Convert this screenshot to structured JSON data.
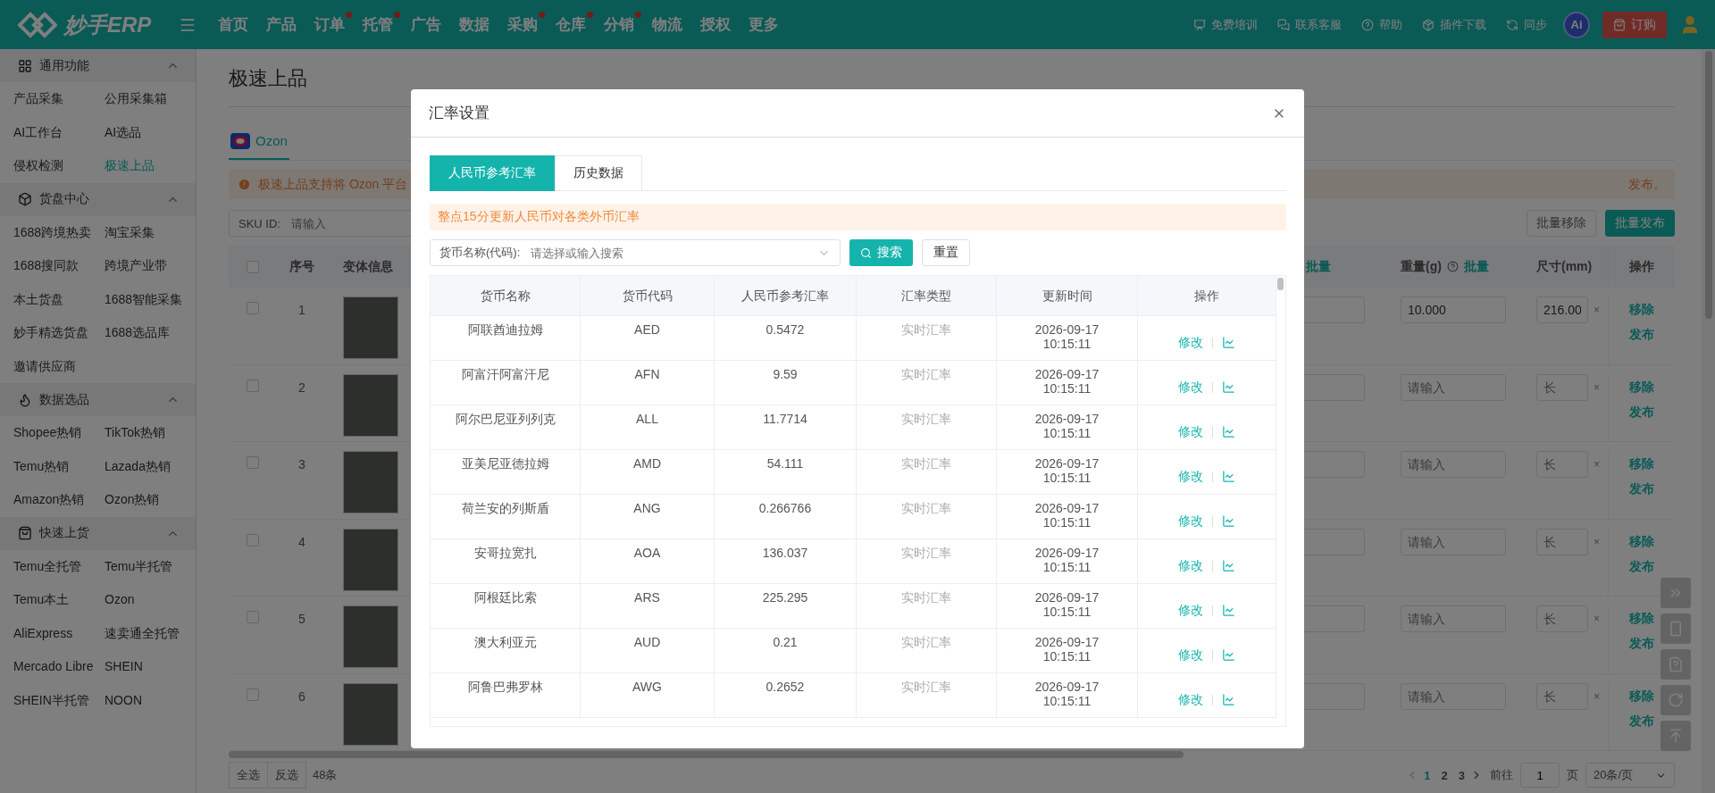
{
  "topbar": {
    "logo_text": "妙手ERP",
    "nav": [
      {
        "label": "首页",
        "dot": false
      },
      {
        "label": "产品",
        "dot": false
      },
      {
        "label": "订单",
        "dot": true
      },
      {
        "label": "托管",
        "dot": true
      },
      {
        "label": "广告",
        "dot": false
      },
      {
        "label": "数据",
        "dot": false
      },
      {
        "label": "采购",
        "dot": true
      },
      {
        "label": "仓库",
        "dot": true
      },
      {
        "label": "分销",
        "dot": true
      },
      {
        "label": "物流",
        "dot": false
      },
      {
        "label": "授权",
        "dot": false
      },
      {
        "label": "更多",
        "dot": false
      }
    ],
    "tools": [
      {
        "label": "免费培训"
      },
      {
        "label": "联系客服"
      },
      {
        "label": "帮助"
      },
      {
        "label": "插件下载"
      },
      {
        "label": "同步"
      }
    ],
    "ai_badge": "Ai",
    "order_button": "订购"
  },
  "sidebar": {
    "groups": [
      {
        "title": "通用功能",
        "expanded": true,
        "items": [
          {
            "label": "产品采集",
            "selected": false
          },
          {
            "label": "公用采集箱",
            "selected": false
          },
          {
            "label": "AI工作台",
            "selected": false
          },
          {
            "label": "AI选品",
            "selected": false
          },
          {
            "label": "侵权检测",
            "selected": false
          },
          {
            "label": "极速上品",
            "selected": true
          }
        ]
      },
      {
        "title": "货盘中心",
        "expanded": true,
        "items": [
          {
            "label": "1688跨境热卖",
            "selected": false
          },
          {
            "label": "淘宝采集",
            "selected": false
          },
          {
            "label": "1688搜同款",
            "selected": false
          },
          {
            "label": "跨境产业带",
            "selected": false
          },
          {
            "label": "本土货盘",
            "selected": false
          },
          {
            "label": "1688智能采集",
            "selected": false
          },
          {
            "label": "妙手精选货盘",
            "selected": false
          },
          {
            "label": "1688选品库",
            "selected": false
          },
          {
            "label": "邀请供应商",
            "selected": false
          }
        ]
      },
      {
        "title": "数据选品",
        "expanded": true,
        "items": [
          {
            "label": "Shopee热销",
            "selected": false
          },
          {
            "label": "TikTok热销",
            "selected": false
          },
          {
            "label": "Temu热销",
            "selected": false
          },
          {
            "label": "Lazada热销",
            "selected": false
          },
          {
            "label": "Amazon热销",
            "selected": false
          },
          {
            "label": "Ozon热销",
            "selected": false
          }
        ]
      },
      {
        "title": "快速上货",
        "expanded": true,
        "items": [
          {
            "label": "Temu全托管",
            "selected": false
          },
          {
            "label": "Temu半托管",
            "selected": false
          },
          {
            "label": "Temu本土",
            "selected": false
          },
          {
            "label": "Ozon",
            "selected": false
          },
          {
            "label": "AliExpress",
            "selected": false
          },
          {
            "label": "速卖通全托管",
            "selected": false
          },
          {
            "label": "Mercado Libre",
            "selected": false
          },
          {
            "label": "SHEIN",
            "selected": false
          },
          {
            "label": "SHEIN半托管",
            "selected": false
          },
          {
            "label": "NOON",
            "selected": false
          }
        ]
      }
    ]
  },
  "page": {
    "title": "极速上品",
    "platform_tab": {
      "label": "Ozon",
      "selected": true
    },
    "alert": {
      "visible_start": "极速上品支持将 Ozon 平台",
      "visible_end": "发布。"
    },
    "sku_filter": {
      "label": "SKU ID:",
      "placeholder": "请输入"
    },
    "buttons": [
      "批量移除",
      "批量发布"
    ],
    "table": {
      "header_checked": false,
      "columns": {
        "index": "序号",
        "variant": "变体信息",
        "column_4_action": "批量",
        "weight": "重量(g)",
        "weight_action": "批量",
        "size": "尺寸(mm)",
        "actions": "操作"
      },
      "rows": [
        {
          "checked": false,
          "index": "1",
          "weight": "10.000",
          "size": "216.00",
          "size_separator": "×",
          "actions": [
            "移除",
            "发布"
          ]
        },
        {
          "checked": false,
          "index": "2",
          "weight_placeholder": "请输入",
          "size_placeholder": "长",
          "size_separator": "×",
          "actions": [
            "移除",
            "发布"
          ]
        },
        {
          "checked": false,
          "index": "3",
          "weight_placeholder": "请输入",
          "size_placeholder": "长",
          "size_separator": "×",
          "actions": [
            "移除",
            "发布"
          ]
        },
        {
          "checked": false,
          "index": "4",
          "weight_placeholder": "请输入",
          "size_placeholder": "长",
          "size_separator": "×",
          "actions": [
            "移除",
            "发布"
          ]
        },
        {
          "checked": false,
          "index": "5",
          "weight_placeholder": "请输入",
          "size_placeholder": "长",
          "size_separator": "×",
          "actions": [
            "移除",
            "发布"
          ]
        },
        {
          "checked": false,
          "index": "6",
          "weight_placeholder": "请输入",
          "size_placeholder": "长",
          "size_separator": "×",
          "actions": [
            "移除",
            "发布"
          ]
        }
      ]
    },
    "footer": {
      "select_all": "全选",
      "invert": "反选",
      "count": "48条",
      "pages": [
        {
          "label": "1",
          "selected": true
        },
        {
          "label": "2",
          "selected": false
        },
        {
          "label": "3",
          "selected": false
        }
      ],
      "goto_label": "前往",
      "goto_value": "1",
      "page_unit": "页",
      "page_size": "20条/页"
    }
  },
  "modal": {
    "title": "汇率设置",
    "tabs": [
      {
        "label": "人民币参考汇率",
        "selected": true
      },
      {
        "label": "历史数据",
        "selected": false
      }
    ],
    "notice": "整点15分更新人民币对各类外币汇率",
    "search": {
      "label": "货币名称(代码):",
      "placeholder": "请选择或输入搜索",
      "search_button": "搜索",
      "reset_button": "重置"
    },
    "table": {
      "columns": [
        "货币名称",
        "货币代码",
        "人民币参考汇率",
        "汇率类型",
        "更新时间",
        "操作"
      ],
      "rows": [
        {
          "name": "阿联酋迪拉姆",
          "code": "AED",
          "rate": "0.5472",
          "type": "实时汇率",
          "date": "2026-09-17",
          "time": "10:15:11",
          "action": "修改"
        },
        {
          "name": "阿富汗阿富汗尼",
          "code": "AFN",
          "rate": "9.59",
          "type": "实时汇率",
          "date": "2026-09-17",
          "time": "10:15:11",
          "action": "修改"
        },
        {
          "name": "阿尔巴尼亚列列克",
          "code": "ALL",
          "rate": "11.7714",
          "type": "实时汇率",
          "date": "2026-09-17",
          "time": "10:15:11",
          "action": "修改"
        },
        {
          "name": "亚美尼亚德拉姆",
          "code": "AMD",
          "rate": "54.111",
          "type": "实时汇率",
          "date": "2026-09-17",
          "time": "10:15:11",
          "action": "修改"
        },
        {
          "name": "荷兰安的列斯盾",
          "code": "ANG",
          "rate": "0.266766",
          "type": "实时汇率",
          "date": "2026-09-17",
          "time": "10:15:11",
          "action": "修改"
        },
        {
          "name": "安哥拉宽扎",
          "code": "AOA",
          "rate": "136.037",
          "type": "实时汇率",
          "date": "2026-09-17",
          "time": "10:15:11",
          "action": "修改"
        },
        {
          "name": "阿根廷比索",
          "code": "ARS",
          "rate": "225.295",
          "type": "实时汇率",
          "date": "2026-09-17",
          "time": "10:15:11",
          "action": "修改"
        },
        {
          "name": "澳大利亚元",
          "code": "AUD",
          "rate": "0.21",
          "type": "实时汇率",
          "date": "2026-09-17",
          "time": "10:15:11",
          "action": "修改"
        },
        {
          "name": "阿鲁巴弗罗林",
          "code": "AWG",
          "rate": "0.2652",
          "type": "实时汇率",
          "date": "2026-09-17",
          "time": "10:15:11",
          "action": "修改"
        }
      ]
    }
  }
}
